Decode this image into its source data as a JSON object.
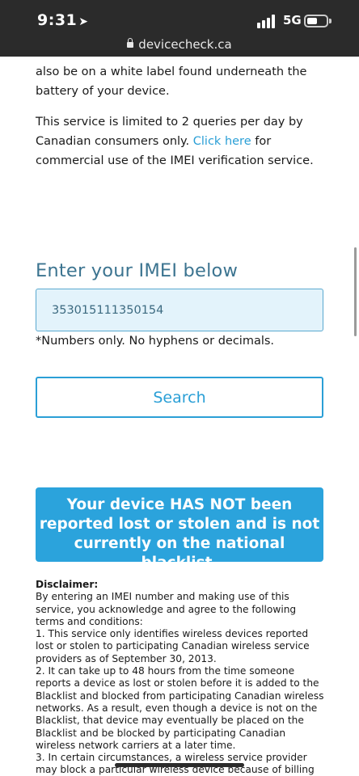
{
  "status": {
    "time": "9:31",
    "network": "5G",
    "url": "devicecheck.ca"
  },
  "content": {
    "para1": "also be on a white label found underneath the battery of your device.",
    "para2_before": "This service is limited to 2 queries per day by Canadian consumers only. ",
    "para2_link": "Click here",
    "para2_after": " for commercial use of the IMEI verification service.",
    "imei_heading": "Enter your IMEI below",
    "imei_value": "353015111350154",
    "imei_note": "*Numbers only. No hyphens or decimals.",
    "search_label": "Search",
    "result_text": "Your device HAS NOT been reported lost or stolen and is not currently on the national blacklist.",
    "disclaimer_title": "Disclaimer:",
    "disclaimer_intro": "By entering an IMEI number and making use of this service, you acknowledge and agree to the following terms and conditions:",
    "disclaimer_1": "1. This service only identifies wireless devices reported lost or stolen to participating Canadian wireless service providers as of September 30, 2013.",
    "disclaimer_2": "2. It can take up to 48 hours from the time someone reports a device as lost or stolen before it is added to the Blacklist and blocked from participating Canadian wireless networks. As a result, even though a device is not on the Blacklist, that device may eventually be placed on the Blacklist and be blocked by participating Canadian wireless network carriers at a later time.",
    "disclaimer_3": "3. In certain circumstances, a wireless service provider may block a particular wireless device because of billing issues with the owner. In such cases, the wireless device would not appear"
  },
  "colors": {
    "accent": "#2a9fd6",
    "heading": "#3c7490",
    "result_bg": "#2ba3dc"
  }
}
